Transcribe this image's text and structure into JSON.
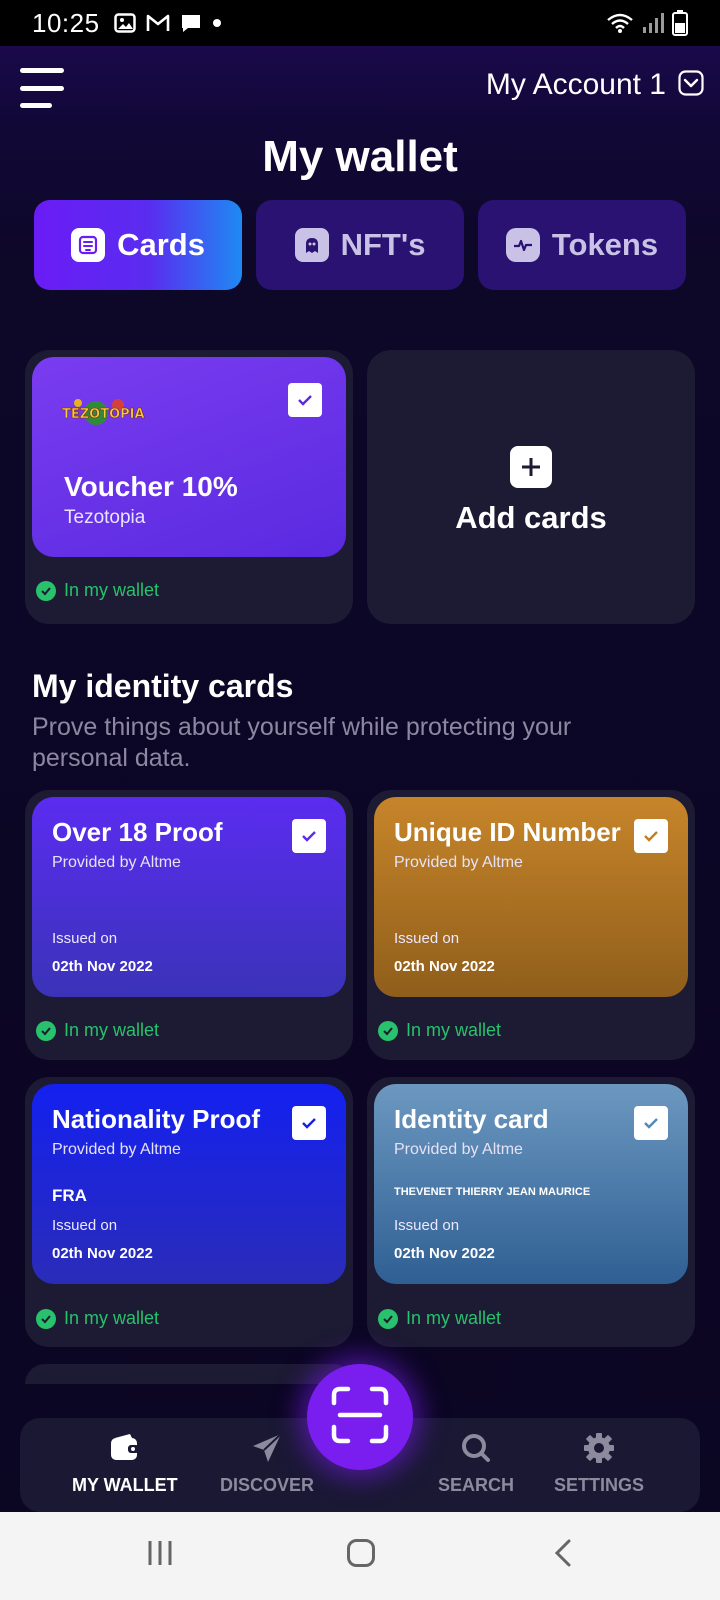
{
  "status_bar": {
    "time": "10:25"
  },
  "header": {
    "account_name": "My Account 1",
    "title": "My wallet"
  },
  "tabs": [
    {
      "label": "Cards",
      "active": true
    },
    {
      "label": "NFT's",
      "active": false
    },
    {
      "label": "Tokens",
      "active": false
    }
  ],
  "voucher": {
    "logo_text": "TEZOTOPIA",
    "title": "Voucher 10%",
    "subtitle": "Tezotopia",
    "status": "In my wallet"
  },
  "add_cards": {
    "label": "Add cards"
  },
  "identity": {
    "title": "My identity cards",
    "description": "Prove things about yourself while protecting your personal data.",
    "cards": [
      {
        "title": "Over 18 Proof",
        "provider": "Provided by Altme",
        "extra": "",
        "issued_label": "Issued on",
        "issued_date": "02th Nov 2022",
        "status": "In my wallet"
      },
      {
        "title": "Unique ID Number",
        "provider": "Provided by Altme",
        "extra": "",
        "issued_label": "Issued on",
        "issued_date": "02th Nov 2022",
        "status": "In my wallet"
      },
      {
        "title": "Nationality Proof",
        "provider": "Provided by Altme",
        "extra": "FRA",
        "issued_label": "Issued on",
        "issued_date": "02th Nov 2022",
        "status": "In my wallet"
      },
      {
        "title": "Identity card",
        "provider": "Provided by Altme",
        "extra": "THEVENET THIERRY JEAN MAURICE",
        "issued_label": "Issued on",
        "issued_date": "02th Nov 2022",
        "status": "In my wallet"
      }
    ]
  },
  "bottom_nav": [
    {
      "label": "MY WALLET",
      "icon": "wallet-icon",
      "active": true
    },
    {
      "label": "DISCOVER",
      "icon": "send-icon",
      "active": false
    },
    {
      "label": "SEARCH",
      "icon": "search-icon",
      "active": false
    },
    {
      "label": "SETTINGS",
      "icon": "gear-icon",
      "active": false
    }
  ],
  "colors": {
    "accent": "#7a1ef0",
    "status_green": "#27c26b",
    "card_over18": "#5b2cf0",
    "card_unique": "#c07f23",
    "card_nationality": "#1a20e0",
    "card_identity": "#4f8bb8"
  }
}
